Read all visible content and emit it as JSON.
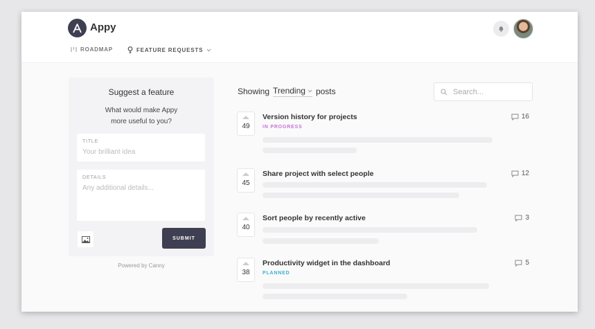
{
  "app": {
    "name": "Appy",
    "logo_letter": "A"
  },
  "nav": {
    "roadmap": "ROADMAP",
    "feature_requests": "FEATURE REQUESTS"
  },
  "suggest": {
    "title": "Suggest a feature",
    "subtitle_line1": "What would make Appy",
    "subtitle_line2": "more useful to you?",
    "title_label": "TITLE",
    "title_placeholder": "Your brilliant idea",
    "details_label": "DETAILS",
    "details_placeholder": "Any additional details...",
    "submit": "SUBMIT",
    "powered_by": "Powered by Canny"
  },
  "posts_header": {
    "showing": "Showing",
    "sort": "Trending",
    "posts": "posts",
    "search_placeholder": "Search..."
  },
  "posts": [
    {
      "votes": "49",
      "title": "Version history for projects",
      "status": "IN PROGRESS",
      "comments": "16"
    },
    {
      "votes": "45",
      "title": "Share project with select people",
      "status": "",
      "comments": "12"
    },
    {
      "votes": "40",
      "title": "Sort people by recently active",
      "status": "",
      "comments": "3"
    },
    {
      "votes": "38",
      "title": "Productivity widget in the dashboard",
      "status": "PLANNED",
      "comments": "5"
    }
  ],
  "colors": {
    "accent": "#3f3f52",
    "in_progress": "#c774d4",
    "planned": "#3db0d1"
  }
}
